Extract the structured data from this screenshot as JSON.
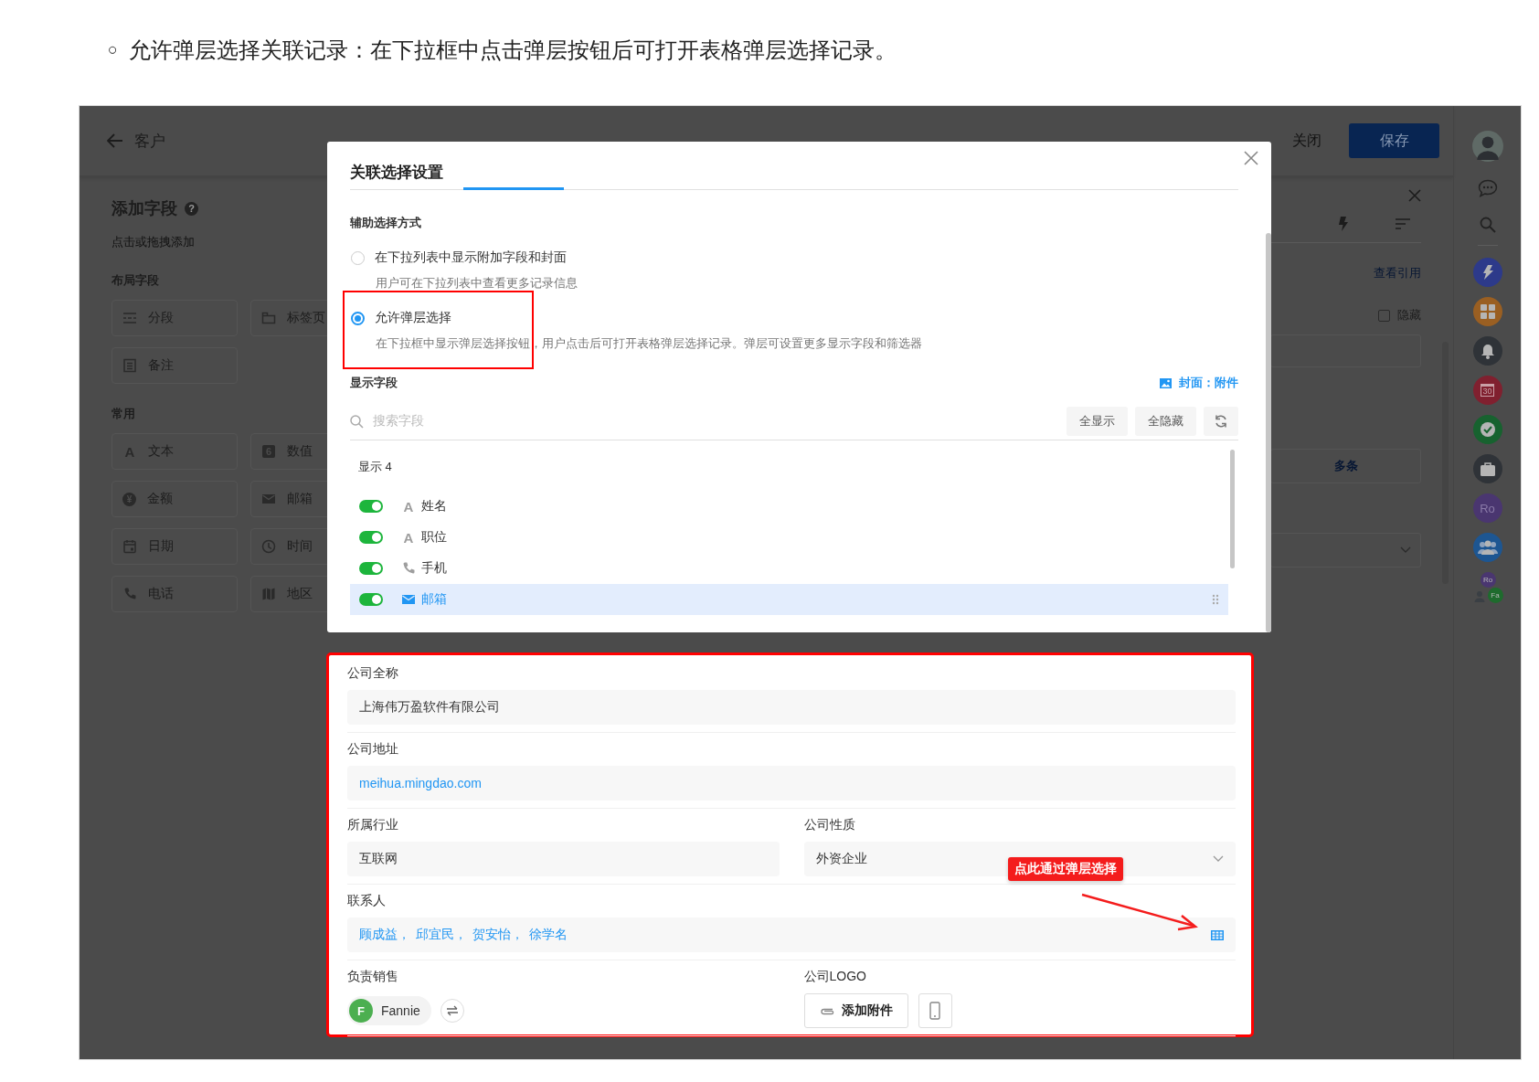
{
  "intro": {
    "bullet": "○",
    "text": "允许弹层选择关联记录：在下拉框中点击弹层按钮后可打开表格弹层选择记录。"
  },
  "header": {
    "title": "客户",
    "close_label": "关闭",
    "save_label": "保存"
  },
  "field_panel": {
    "title": "添加字段",
    "help_glyph": "?",
    "hint": "点击或拖拽添加",
    "groups": [
      {
        "title": "布局字段",
        "items": [
          {
            "label": "分段",
            "kind": "section"
          },
          {
            "label": "标签页",
            "kind": "tab"
          },
          {
            "label": "备注",
            "kind": "note"
          }
        ]
      },
      {
        "title": "常用",
        "items": [
          {
            "label": "文本",
            "kind": "text",
            "glyph": "A"
          },
          {
            "label": "数值",
            "kind": "number",
            "glyph": "6"
          },
          {
            "label": "金额",
            "kind": "amount",
            "glyph": "¥"
          },
          {
            "label": "邮箱",
            "kind": "email"
          },
          {
            "label": "日期",
            "kind": "date"
          },
          {
            "label": "时间",
            "kind": "time"
          },
          {
            "label": "电话",
            "kind": "phone"
          },
          {
            "label": "地区",
            "kind": "region"
          }
        ]
      }
    ]
  },
  "settings_panel": {
    "view_references": "查看引用",
    "hidden": {
      "label": "隐藏",
      "checked": false
    },
    "multi_button": "多条"
  },
  "rail": [
    {
      "kind": "user"
    },
    {
      "kind": "chat"
    },
    {
      "kind": "search"
    },
    {
      "kind": "flash",
      "color": "#2d3a8a"
    },
    {
      "kind": "grid",
      "color": "#9a5f22"
    },
    {
      "kind": "bell",
      "color": "#2f3338"
    },
    {
      "kind": "calendar",
      "color": "#80202f",
      "text": "30"
    },
    {
      "kind": "check",
      "color": "#17622f"
    },
    {
      "kind": "briefcase",
      "color": "#2f3338"
    },
    {
      "kind": "initials",
      "color": "#4a3670",
      "text": "Ro"
    },
    {
      "kind": "team",
      "color": "#1d5692"
    },
    {
      "kind": "group",
      "members": [
        {
          "text": "Ro",
          "color": "#4a3670"
        },
        {
          "text": "Fa",
          "color": "#1e6b2d"
        }
      ]
    }
  ],
  "modal": {
    "title": "关联选择设置",
    "assist_label": "辅助选择方式",
    "options": [
      {
        "label": "在下拉列表中显示附加字段和封面",
        "description": "用户可在下拉列表中查看更多记录信息",
        "selected": false
      },
      {
        "label": "允许弹层选择",
        "description": "在下拉框中显示弹层选择按钮，用户点击后可打开表格弹层选择记录。弹层可设置更多显示字段和筛选器",
        "selected": true
      }
    ],
    "display_label": "显示字段",
    "cover_link": "封面：附件",
    "search_placeholder": "搜索字段",
    "show_all": "全显示",
    "hide_all": "全隐藏",
    "shown_count": "显示 4",
    "fields": [
      {
        "label": "姓名",
        "kind": "text",
        "glyph": "A",
        "on": true,
        "selected": false
      },
      {
        "label": "职位",
        "kind": "text",
        "glyph": "A",
        "on": true,
        "selected": false
      },
      {
        "label": "手机",
        "kind": "phone",
        "on": true,
        "selected": false
      },
      {
        "label": "邮箱",
        "kind": "email",
        "on": true,
        "selected": true
      }
    ]
  },
  "form": {
    "rows": [
      [
        {
          "label": "公司全称",
          "kind": "text",
          "value": "上海伟万盈软件有限公司"
        }
      ],
      [
        {
          "label": "公司地址",
          "kind": "link",
          "value": "meihua.mingdao.com"
        }
      ],
      [
        {
          "label": "所属行业",
          "kind": "text",
          "value": "互联网"
        },
        {
          "label": "公司性质",
          "kind": "select",
          "value": "外资企业"
        }
      ],
      [
        {
          "label": "联系人",
          "kind": "relation",
          "values": [
            "顾成益，",
            "邱宜民，",
            "贺安怡，",
            "徐学名"
          ]
        }
      ],
      [
        {
          "label": "负责销售",
          "kind": "user",
          "initial": "F",
          "name": "Fannie",
          "color": "#4caf50"
        },
        {
          "label": "公司LOGO",
          "kind": "attachment",
          "button": "添加附件"
        }
      ]
    ]
  },
  "callout": "点此通过弹层选择"
}
